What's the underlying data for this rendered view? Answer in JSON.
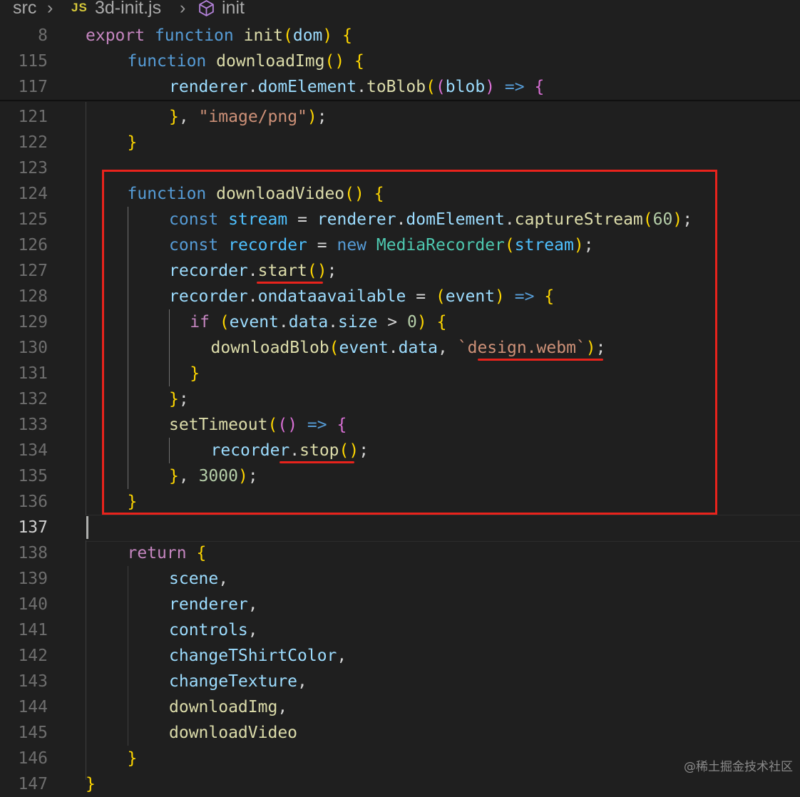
{
  "breadcrumb": {
    "folder": "src",
    "file_icon": "JS",
    "file": "3d-init.js",
    "symbol": "init",
    "symbol_icon": "cube-symbol-icon"
  },
  "sticky_lines": [
    {
      "number": "8",
      "text": "export function init(dom) {"
    },
    {
      "number": "115",
      "text": "function downloadImg() {"
    },
    {
      "number": "117",
      "text": "renderer.domElement.toBlob((blob) => {"
    }
  ],
  "lines": [
    {
      "number": "121",
      "text": "}, \"image/png\");"
    },
    {
      "number": "122",
      "text": "}"
    },
    {
      "number": "123",
      "text": ""
    },
    {
      "number": "124",
      "text": "function downloadVideo() {"
    },
    {
      "number": "125",
      "text": "const stream = renderer.domElement.captureStream(60);"
    },
    {
      "number": "126",
      "text": "const recorder = new MediaRecorder(stream);"
    },
    {
      "number": "127",
      "text": "recorder.start();"
    },
    {
      "number": "128",
      "text": "recorder.ondataavailable = (event) => {"
    },
    {
      "number": "129",
      "text": "if (event.data.size > 0) {"
    },
    {
      "number": "130",
      "text": "downloadBlob(event.data, `design.webm`);"
    },
    {
      "number": "131",
      "text": "}"
    },
    {
      "number": "132",
      "text": "};"
    },
    {
      "number": "133",
      "text": "setTimeout(() => {"
    },
    {
      "number": "134",
      "text": "recorder.stop();"
    },
    {
      "number": "135",
      "text": "}, 3000);"
    },
    {
      "number": "136",
      "text": "}"
    },
    {
      "number": "137",
      "text": ""
    },
    {
      "number": "138",
      "text": "return {"
    },
    {
      "number": "139",
      "text": "scene,"
    },
    {
      "number": "140",
      "text": "renderer,"
    },
    {
      "number": "141",
      "text": "controls,"
    },
    {
      "number": "142",
      "text": "changeTShirtColor,"
    },
    {
      "number": "143",
      "text": "changeTexture,"
    },
    {
      "number": "144",
      "text": "downloadImg,"
    },
    {
      "number": "145",
      "text": "downloadVideo"
    },
    {
      "number": "146",
      "text": "}"
    },
    {
      "number": "147",
      "text": "}"
    }
  ],
  "active_line": "137",
  "annotation_color": "#e8231c",
  "watermark": "@稀土掘金技术社区"
}
